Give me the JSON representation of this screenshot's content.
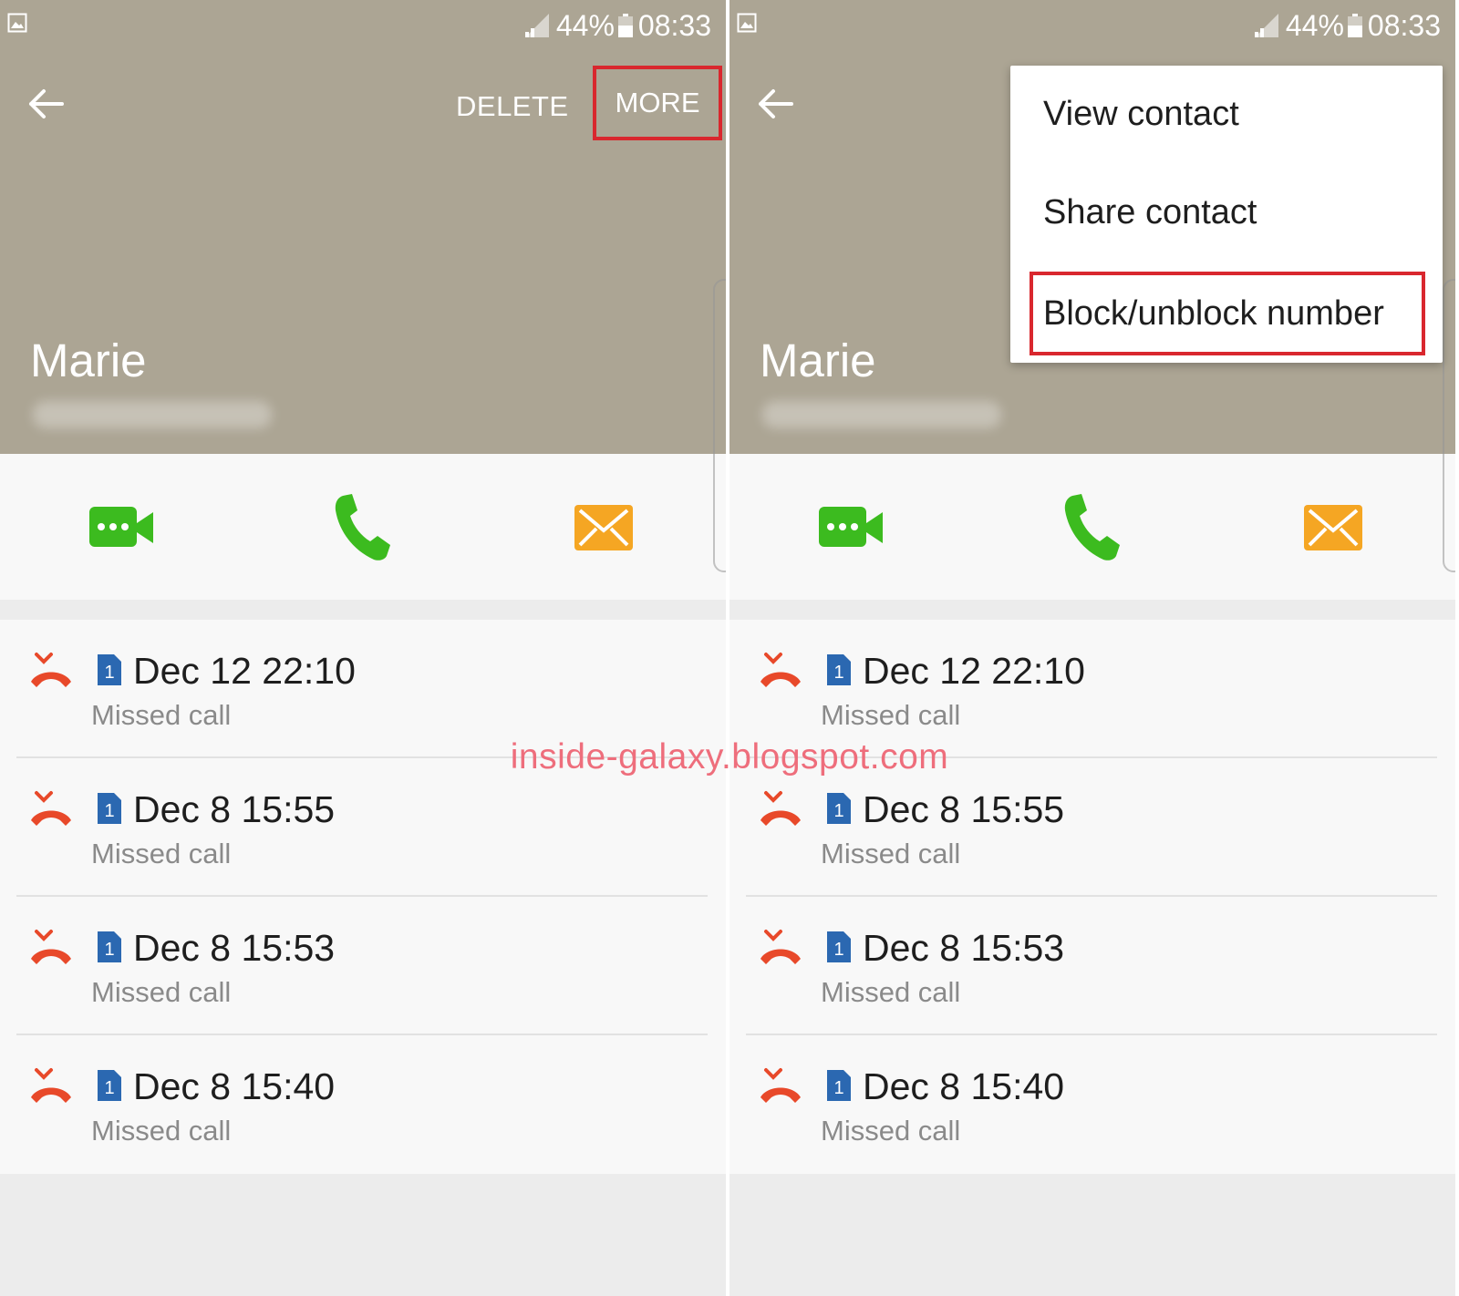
{
  "status_bar": {
    "battery_percent": "44%",
    "time": "08:33"
  },
  "screens": [
    {
      "header": {
        "delete_label": "DELETE",
        "more_label": "MORE",
        "contact_name": "Marie"
      }
    },
    {
      "header": {
        "contact_name": "Marie"
      },
      "menu": {
        "items": [
          "View contact",
          "Share contact",
          "Block/unblock number"
        ]
      }
    }
  ],
  "calls": [
    {
      "date": "Dec 12 22:10",
      "type": "Missed call",
      "sim": "1"
    },
    {
      "date": "Dec 8 15:55",
      "type": "Missed call",
      "sim": "1"
    },
    {
      "date": "Dec 8 15:53",
      "type": "Missed call",
      "sim": "1"
    },
    {
      "date": "Dec 8 15:40",
      "type": "Missed call",
      "sim": "1"
    }
  ],
  "watermark": "inside-galaxy.blogspot.com",
  "colors": {
    "header_bg": "#aca594",
    "highlight_border": "#d9272e",
    "video_green": "#3cbb1f",
    "phone_green": "#3cbb1f",
    "message_orange": "#f5a623",
    "missed_red": "#e8492a",
    "sim_blue": "#2b68b1"
  },
  "icons": [
    "gallery-icon",
    "signal-icon",
    "battery-icon",
    "back-arrow-icon",
    "video-call-icon",
    "phone-icon",
    "message-icon",
    "missed-call-icon",
    "sim-1-icon"
  ]
}
